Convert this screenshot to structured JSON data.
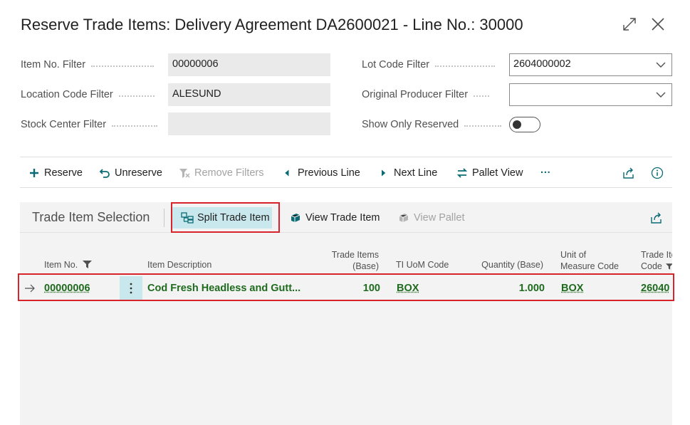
{
  "dialog": {
    "title": "Reserve Trade Items: Delivery Agreement DA2600021 - Line No.: 30000",
    "expand_icon": "expand-icon",
    "close_icon": "close-icon"
  },
  "filters": {
    "item_no": {
      "label": "Item No. Filter",
      "value": "00000006"
    },
    "location_code": {
      "label": "Location Code Filter",
      "value": "ALESUND"
    },
    "stock_center": {
      "label": "Stock Center Filter",
      "value": ""
    },
    "lot_code": {
      "label": "Lot Code Filter",
      "value": "2604000002"
    },
    "original_producer": {
      "label": "Original Producer Filter",
      "value": ""
    },
    "show_only_reserved": {
      "label": "Show Only Reserved",
      "on": false
    }
  },
  "actions": {
    "reserve": "Reserve",
    "unreserve": "Unreserve",
    "remove_filters": "Remove Filters",
    "previous_line": "Previous Line",
    "next_line": "Next Line",
    "pallet_view": "Pallet View",
    "more": "···"
  },
  "part": {
    "title": "Trade Item Selection",
    "split_trade_item": "Split Trade Item",
    "view_trade_item": "View Trade Item",
    "view_pallet": "View Pallet"
  },
  "table": {
    "headers": {
      "item_no": "Item No.",
      "item_description": "Item Description",
      "trade_items_1": "Trade Items",
      "trade_items_2": "(Base)",
      "ti_uom_code": "TI UoM Code",
      "quantity_base": "Quantity (Base)",
      "unit_of_measure_1": "Unit of",
      "unit_of_measure_2": "Measure Code",
      "trade_item_code_1": "Trade Ite",
      "trade_item_code_2": "Code"
    },
    "rows": [
      {
        "item_no": "00000006",
        "item_description": "Cod Fresh Headless and Gutt...",
        "trade_items_base": "100",
        "ti_uom_code": "BOX",
        "quantity_base": "1.000",
        "unit_of_measure_code": "BOX",
        "trade_item_code": "26040"
      }
    ]
  },
  "colors": {
    "accent": "#008489",
    "link_green": "#1e6b1e",
    "highlight_red": "#d9232b",
    "selected_bg": "#c8e8ed"
  }
}
